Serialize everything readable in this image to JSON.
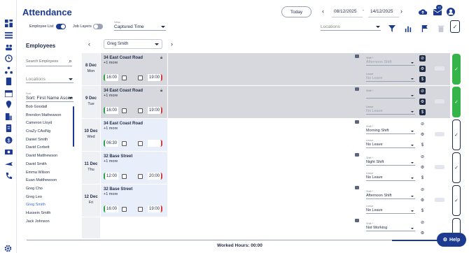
{
  "header": {
    "title": "Attendance",
    "today_label": "Today",
    "date_from": "08/12/2025",
    "date_sep": "-",
    "date_to": "14/12/2025",
    "notification_count": "12"
  },
  "toolbar": {
    "employee_list_label": "Employee List",
    "job_layers_label": "Job Layers",
    "view_caption": "View",
    "view_value": "Captured Time",
    "locations_placeholder": "Locations"
  },
  "employees_panel": {
    "title": "Employees",
    "search_placeholder": "Search Employees",
    "locations_placeholder": "Locations",
    "sort_caption": "Sort",
    "sort_value": "Sort: First Name Ascen",
    "list": [
      "Bob Goodall",
      "Brendon Mathewson",
      "Cameron Lloyd",
      "CraZy CAsiNg",
      "Daniel Smith",
      "David Corbett",
      "David Matthewson",
      "David Smith",
      "Emma Wilson",
      "Euan Matthewson",
      "Greg Cho",
      "Greg Leo",
      "Greg Smith",
      "Hussein Smith",
      "Jack Johnson"
    ]
  },
  "roster": {
    "selected_employee": "Greg Smith",
    "days": [
      {
        "date": "8 Dec",
        "dow": "Mon",
        "location": "34 East Coast Road",
        "more": "+1 more",
        "start": "16:00",
        "end": "19:00",
        "shift_caption": "Shift *",
        "shift": "Afternoon Shift",
        "leave_caption": "Leave",
        "leave": "No Leave",
        "state": "done",
        "locked": true
      },
      {
        "date": "9 Dec",
        "dow": "Tue",
        "location": "34 East Coast Road",
        "more": "+1 more",
        "start": "16:00",
        "end": "19:00",
        "shift_caption": "Shift *",
        "shift": "",
        "leave_caption": "Leave",
        "leave": "No Leave",
        "state": "done",
        "locked": true
      },
      {
        "date": "10 Dec",
        "dow": "Wed",
        "location": "34 East Coast Road",
        "more": "+1 more",
        "start": "06:30",
        "end": "",
        "shift_caption": "Shift *",
        "shift": "Morning Shift",
        "leave_caption": "Leave",
        "leave": "No Leave",
        "state": "open",
        "locked": false
      },
      {
        "date": "11 Dec",
        "dow": "Thu",
        "location": "32 Base Street",
        "more": "+1 more",
        "start": "12:00",
        "end": "20:00",
        "shift_caption": "Shift *",
        "shift": "Night Shift",
        "leave_caption": "Leave",
        "leave": "No Leave",
        "state": "open",
        "locked": false
      },
      {
        "date": "12 Dec",
        "dow": "Fri",
        "location": "32 Base Street",
        "more": "+1 more",
        "start": "16:00",
        "end": "19:00",
        "shift_caption": "Shift *",
        "shift": "Afternoon Shift",
        "leave_caption": "Leave",
        "leave": "No Leave",
        "state": "open",
        "locked": false
      },
      {
        "date": "",
        "dow": "",
        "location": "",
        "more": "",
        "start": "",
        "end": "",
        "shift_caption": "Shift *",
        "shift": "Not Working",
        "leave_caption": "",
        "leave": "",
        "state": "open",
        "locked": false
      }
    ]
  },
  "footer": {
    "worked_hours": "Worked Hours: 00:00",
    "help_label": "Help"
  },
  "colors": {
    "brand": "#1c3a8f",
    "done": "#35b449",
    "start_bar": "#2ea043",
    "end_bar": "#d43d3d",
    "locked_bg": "#d6d8dd",
    "open_bg": "#e9eefb"
  }
}
